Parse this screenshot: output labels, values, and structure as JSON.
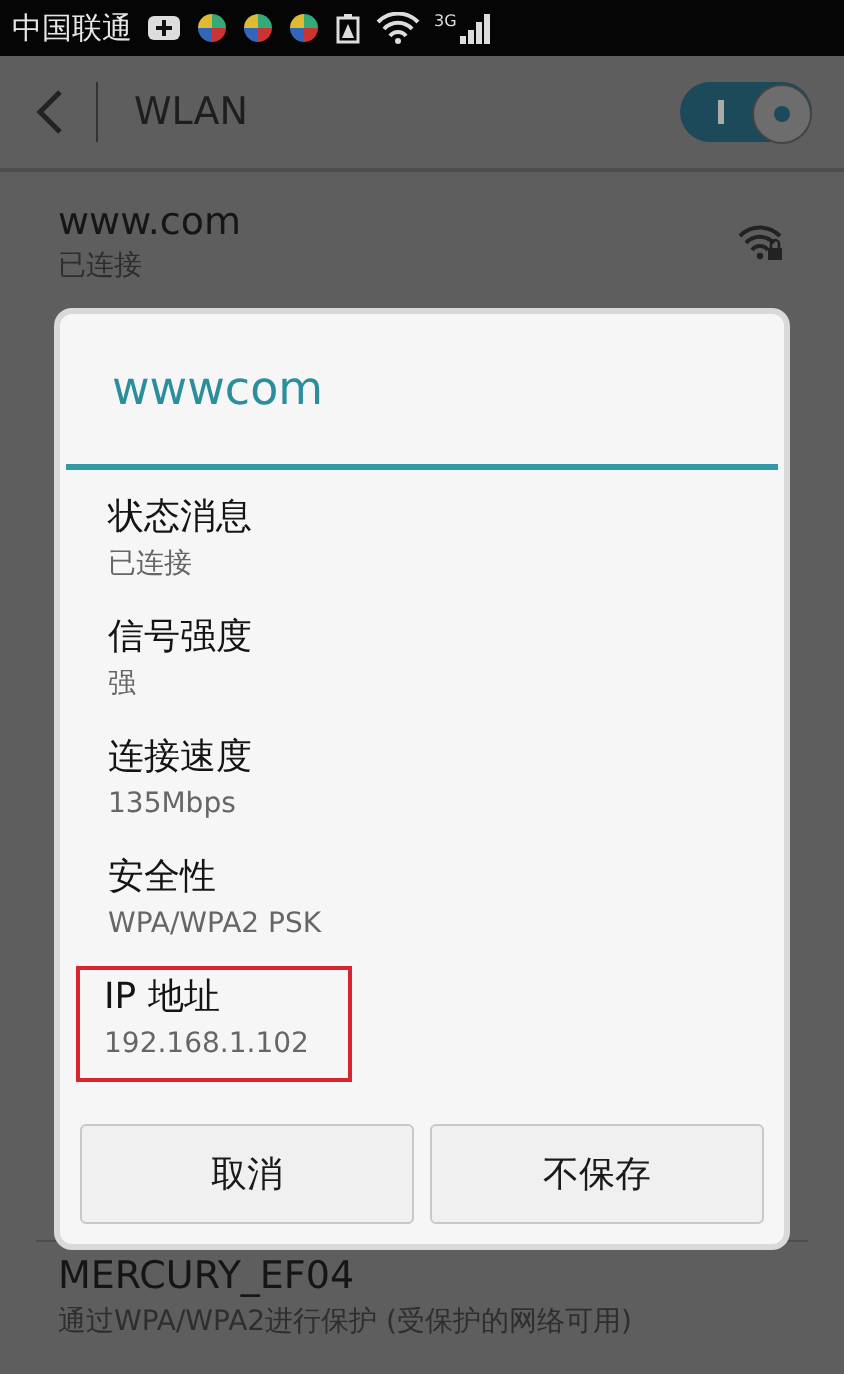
{
  "status_bar": {
    "carrier": "中国联通",
    "network": "3G"
  },
  "app_bar": {
    "title": "WLAN",
    "wlan_on": true
  },
  "networks": [
    {
      "name": "www.com",
      "status": "已连接",
      "secured": true
    }
  ],
  "dialog": {
    "title": "wwwcom",
    "items": [
      {
        "label": "状态消息",
        "value": "已连接",
        "highlighted": false
      },
      {
        "label": "信号强度",
        "value": "强",
        "highlighted": false
      },
      {
        "label": "连接速度",
        "value": "135Mbps",
        "highlighted": false
      },
      {
        "label": "安全性",
        "value": "WPA/WPA2 PSK",
        "highlighted": false
      },
      {
        "label": "IP 地址",
        "value": "192.168.1.102",
        "highlighted": true
      }
    ],
    "buttons": [
      "取消",
      "不保存"
    ]
  },
  "bottom_network": {
    "name": "MERCURY_EF04",
    "status": "通过WPA/WPA2进行保护 (受保护的网络可用)"
  }
}
